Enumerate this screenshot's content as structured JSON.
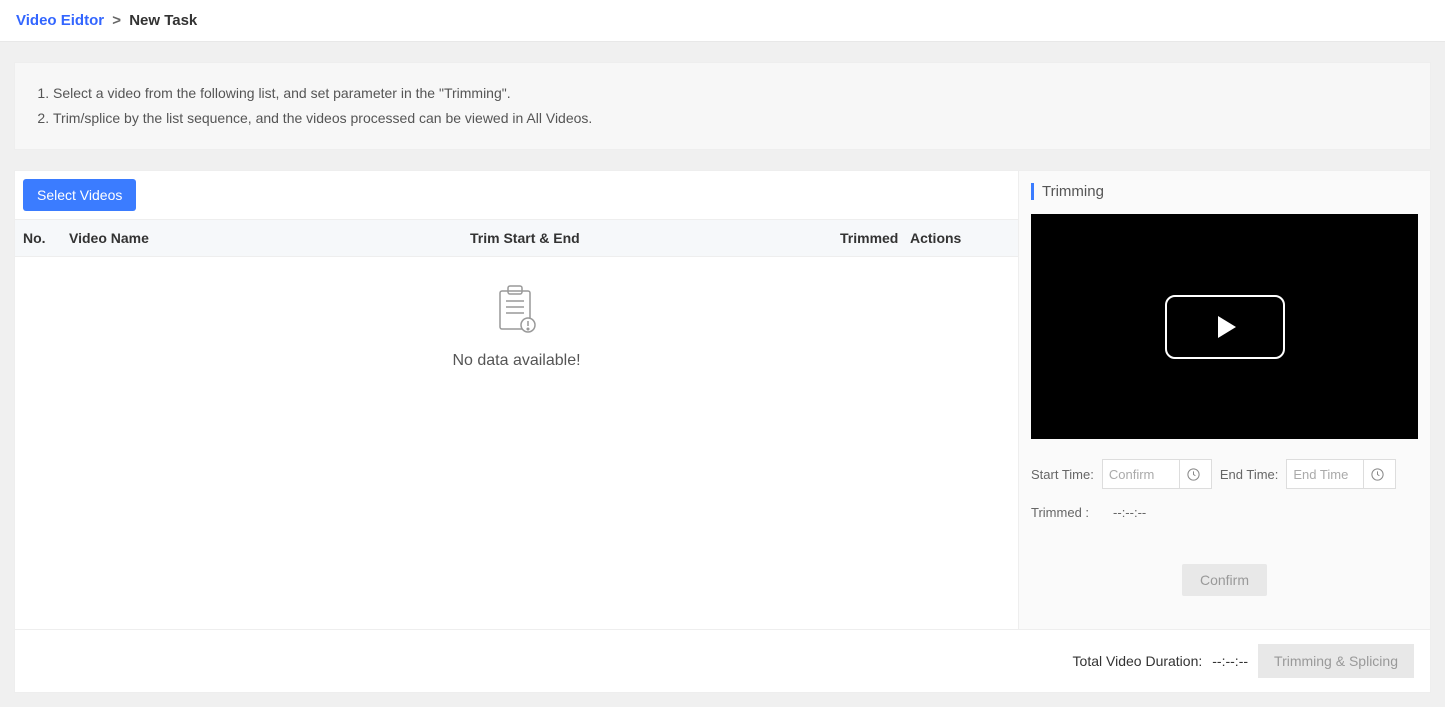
{
  "breadcrumb": {
    "root": "Video Eidtor",
    "sep": ">",
    "current": "New Task"
  },
  "instructions": {
    "items": [
      "Select a video from the following list, and set parameter in the \"Trimming\".",
      "Trim/splice by the list sequence, and the videos processed can be viewed in All Videos."
    ]
  },
  "left": {
    "select_btn": "Select Videos",
    "columns": {
      "no": "No.",
      "name": "Video Name",
      "trim": "Trim Start & End",
      "trimmed": "Trimmed",
      "actions": "Actions"
    },
    "empty": "No data available!"
  },
  "right": {
    "title": "Trimming",
    "start_label": "Start Time:",
    "start_placeholder": "Confirm",
    "end_label": "End Time:",
    "end_placeholder": "End Time",
    "trimmed_label": "Trimmed :",
    "trimmed_value": "--:--:--",
    "confirm_btn": "Confirm"
  },
  "footer": {
    "duration_label": "Total Video Duration:",
    "duration_value": "--:--:--",
    "action_btn": "Trimming & Splicing"
  }
}
